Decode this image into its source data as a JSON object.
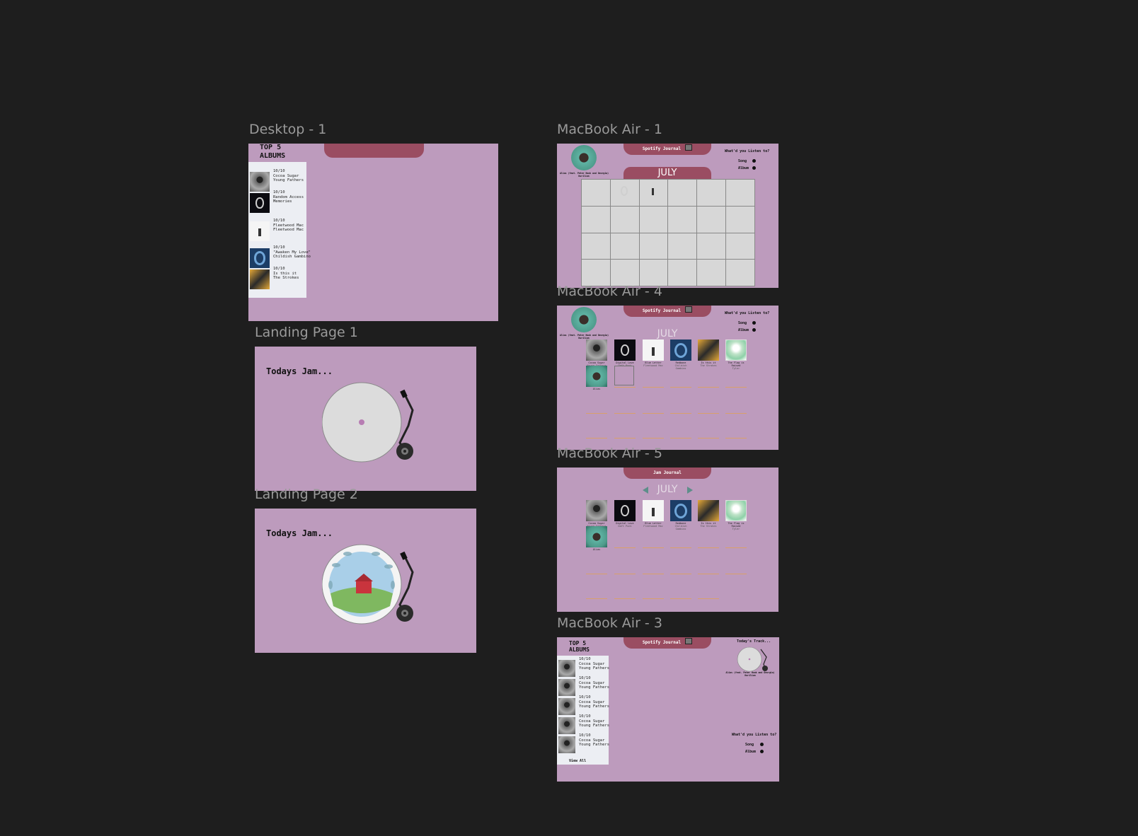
{
  "frames": {
    "desktop1": {
      "label": "Desktop - 1"
    },
    "landing1": {
      "label": "Landing Page 1"
    },
    "landing2": {
      "label": "Landing Page 2"
    },
    "mba1": {
      "label": "MacBook Air - 1"
    },
    "mba4": {
      "label": "MacBook Air - 4"
    },
    "mba5": {
      "label": "MacBook Air - 5"
    },
    "mba3": {
      "label": "MacBook Air - 3"
    }
  },
  "top5": {
    "title_line1": "TOP 5",
    "title_line2": "ALBUMS",
    "rows": [
      {
        "rating": "10/10",
        "line1": "Cocoa Sugar",
        "line2": "Young Fathers",
        "icon": "cowboy-cover"
      },
      {
        "rating": "10/10",
        "line1": "Random Access",
        "line2": "Memories",
        "icon": "daft-cover"
      },
      {
        "rating": "10/10",
        "line1": "Fleetwood Mac",
        "line2": "Fleetwood Mac",
        "icon": "fleetwood-cover"
      },
      {
        "rating": "10/10",
        "line1": "\"Awaken My Love\"",
        "line2": "Childish Gambino",
        "icon": "gambino-cover"
      },
      {
        "rating": "10/10",
        "line1": "Is this it",
        "line2": "The Strokes",
        "icon": "strokes-cover"
      }
    ]
  },
  "landing": {
    "todays_jam": "Todays Jam..."
  },
  "header": {
    "spotify_journal": "Spotify Journal",
    "jam_journal": "Jam Journal"
  },
  "calendar": {
    "month": "JULY"
  },
  "sidebar_now": {
    "caption_line1": "Alias (feat. Peter Hook and Georgia)",
    "caption_line2": "Kurilian"
  },
  "listen": {
    "question": "What'd you Listen to?",
    "song": "Song",
    "album": "Album"
  },
  "mba4_albums": [
    {
      "title": "Cocoa Sugar",
      "artist": "Young Fathers"
    },
    {
      "title": "Digital Love",
      "artist": "Daft Punk"
    },
    {
      "title": "Blue Letter",
      "artist": "Fleetwood Mac"
    },
    {
      "title": "Redbone",
      "artist": "Childish Gambino"
    },
    {
      "title": "Is this it",
      "artist": "The Strokes"
    },
    {
      "title": "The Flag is Raised",
      "artist": "Tyler"
    },
    {
      "title": "Alias",
      "artist": ""
    }
  ],
  "mba3": {
    "todays_track": "Today's Track...",
    "caption_line1": "Alias (feat. Peter Hook and Georgia)",
    "caption_line2": "Kurilian",
    "view_all": "View All",
    "rows": [
      {
        "rating": "10/10",
        "line1": "Cocoa Sugar",
        "line2": "Young Fathers"
      },
      {
        "rating": "10/10",
        "line1": "Cocoa Sugar",
        "line2": "Young Fathers"
      },
      {
        "rating": "10/10",
        "line1": "Cocoa Sugar",
        "line2": "Young Fathers"
      },
      {
        "rating": "10/10",
        "line1": "Cocoa Sugar",
        "line2": "Young Fathers"
      },
      {
        "rating": "10/10",
        "line1": "Cocoa Sugar",
        "line2": "Young Fathers"
      }
    ]
  },
  "colors": {
    "canvas": "#1e1e1e",
    "frame": "#bd9bbd",
    "accent": "#9a4d62",
    "panel": "#eceef3"
  }
}
